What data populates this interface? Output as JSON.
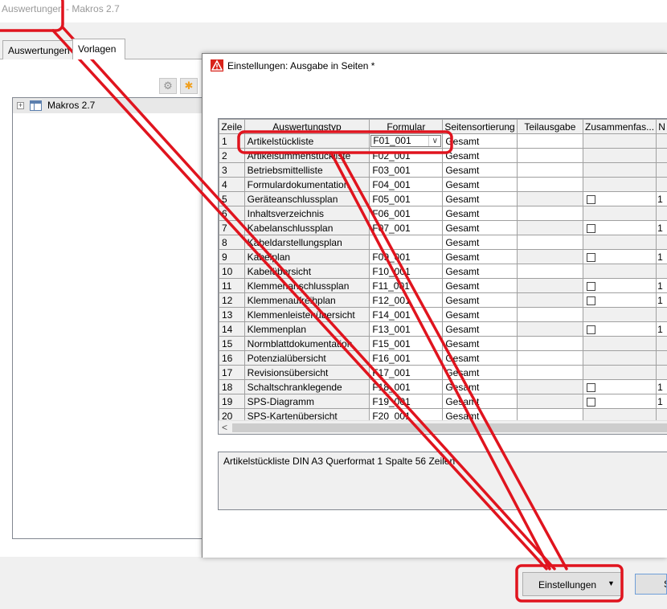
{
  "window": {
    "title": "Auswertungen - Makros 2.7",
    "tabs": [
      {
        "label": "Auswertungen"
      },
      {
        "label": "Vorlagen"
      }
    ],
    "tree": {
      "label": "Makros 2.7",
      "expander": "+"
    },
    "toolbar_icons": [
      "gear-icon",
      "star-icon"
    ],
    "settings_button": "Einstellungen",
    "secondary_button": "S"
  },
  "dialog": {
    "title": "Einstellungen: Ausgabe in Seiten *",
    "columns": [
      "Zeile",
      "Auswertungstyp",
      "Formular",
      "Seitensortierung",
      "Teilausgabe",
      "Zusammenfas...",
      "N"
    ],
    "rows": [
      {
        "num": "1",
        "typ": "Artikelstückliste",
        "formular": "F01_001",
        "sort": "Gesamt",
        "checkbox": false,
        "extra": "",
        "combo": true
      },
      {
        "num": "2",
        "typ": "Artikelsummenstückliste",
        "formular": "F02_001",
        "sort": "Gesamt",
        "checkbox": false,
        "extra": ""
      },
      {
        "num": "3",
        "typ": "Betriebsmittelliste",
        "formular": "F03_001",
        "sort": "Gesamt",
        "checkbox": false,
        "extra": ""
      },
      {
        "num": "4",
        "typ": "Formulardokumentation",
        "formular": "F04_001",
        "sort": "Gesamt",
        "checkbox": false,
        "extra": ""
      },
      {
        "num": "5",
        "typ": "Geräteanschlussplan",
        "formular": "F05_001",
        "sort": "Gesamt",
        "checkbox": true,
        "extra": "1"
      },
      {
        "num": "6",
        "typ": "Inhaltsverzeichnis",
        "formular": "F06_001",
        "sort": "Gesamt",
        "checkbox": false,
        "extra": ""
      },
      {
        "num": "7",
        "typ": "Kabelanschlussplan",
        "formular": "F07_001",
        "sort": "Gesamt",
        "checkbox": true,
        "extra": "1"
      },
      {
        "num": "8",
        "typ": "Kabeldarstellungsplan",
        "formular": "",
        "sort": "Gesamt",
        "checkbox": false,
        "extra": ""
      },
      {
        "num": "9",
        "typ": "Kabelplan",
        "formular": "F09_001",
        "sort": "Gesamt",
        "checkbox": true,
        "extra": "1"
      },
      {
        "num": "10",
        "typ": "Kabelübersicht",
        "formular": "F10_001",
        "sort": "Gesamt",
        "checkbox": false,
        "extra": ""
      },
      {
        "num": "11",
        "typ": "Klemmenanschlussplan",
        "formular": "F11_001",
        "sort": "Gesamt",
        "checkbox": true,
        "extra": "1"
      },
      {
        "num": "12",
        "typ": "Klemmenaufreihplan",
        "formular": "F12_001",
        "sort": "Gesamt",
        "checkbox": true,
        "extra": "1"
      },
      {
        "num": "13",
        "typ": "Klemmenleistenübersicht",
        "formular": "F14_001",
        "sort": "Gesamt",
        "checkbox": false,
        "extra": ""
      },
      {
        "num": "14",
        "typ": "Klemmenplan",
        "formular": "F13_001",
        "sort": "Gesamt",
        "checkbox": true,
        "extra": "1"
      },
      {
        "num": "15",
        "typ": "Normblattdokumentation",
        "formular": "F15_001",
        "sort": "Gesamt",
        "checkbox": false,
        "extra": ""
      },
      {
        "num": "16",
        "typ": "Potenzialübersicht",
        "formular": "F16_001",
        "sort": "Gesamt",
        "checkbox": false,
        "extra": ""
      },
      {
        "num": "17",
        "typ": "Revisionsübersicht",
        "formular": "F17_001",
        "sort": "Gesamt",
        "checkbox": false,
        "extra": ""
      },
      {
        "num": "18",
        "typ": "Schaltschranklegende",
        "formular": "F18_001",
        "sort": "Gesamt",
        "checkbox": true,
        "extra": "1"
      },
      {
        "num": "19",
        "typ": "SPS-Diagramm",
        "formular": "F19_001",
        "sort": "Gesamt",
        "checkbox": true,
        "extra": "1"
      },
      {
        "num": "20",
        "typ": "SPS-Kartenübersicht",
        "formular": "F20_001",
        "sort": "Gesamt",
        "checkbox": false,
        "extra": ""
      }
    ],
    "description": "Artikelstückliste DIN A3 Querformat 1 Spalte 56 Zeilen",
    "scroll_left": "<"
  },
  "annotation_color": "#e0141e"
}
